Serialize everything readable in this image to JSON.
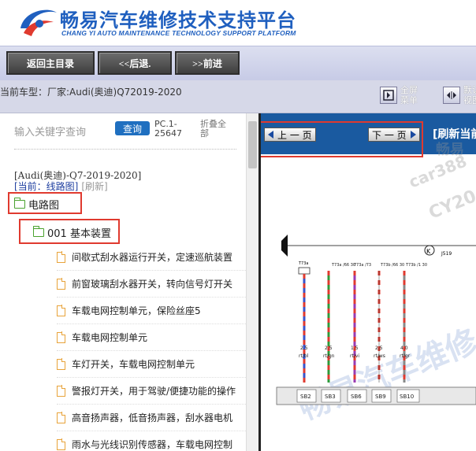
{
  "header": {
    "title": "畅易汽车维修技术支持平台",
    "subtitle": "CHANG YI AUTO MAINTENANCE TECHNOLOGY SUPPORT PLATFORM",
    "colors": {
      "brand": "#1f5fbf",
      "logo_red": "#e03a2f"
    }
  },
  "nav": {
    "home_label": "返回主目录",
    "back_label": "<<后退.",
    "forward_label": ">>前进"
  },
  "info": {
    "model_label": "当前车型：",
    "model_value": "厂家:Audi(奥迪)Q72019-2020",
    "fullscreen_label": "全屏\n菜单",
    "default_label": "默认\n视图"
  },
  "left": {
    "search_placeholder": "输入关键字查询",
    "search_button": "查询",
    "pc_label": "PC.1-25647",
    "fold_label": "折叠全部",
    "crumb_path": "[Audi(奥迪)-Q7-2019-2020]",
    "crumb_current": "[当前：线路图]",
    "crumb_refresh": "[刷新]",
    "tree_root": "电路图",
    "tree_child": "001 基本装置",
    "leaves": [
      "间歇式刮水器运行开关，定速巡航装置",
      "前窗玻璃刮水器开关，转向信号灯开关",
      "车载电网控制单元，保险丝座5",
      "车载电网控制单元",
      "车灯开关，车载电网控制单元",
      "警报灯开关，用于驾驶/便捷功能的操作",
      "高音扬声器，低音扬声器，刮水器电机",
      "雨水与光线识别传感器，车载电网控制"
    ]
  },
  "right": {
    "prev_page": "上 一 页",
    "next_page": "下 一 页",
    "refresh_current": "[刷新当前",
    "watermark_1": "畅易",
    "watermark_2": "car388",
    "watermark_3": "CY20",
    "watermark_4": "畅易汽车维修",
    "diagram": {
      "fuse_top_labels": [
        "T73a /66 30",
        "T73a /73",
        "T73b /66 30",
        "T73b /1 30"
      ],
      "wire_gauges": [
        "2.5",
        "2.5",
        "1.5",
        "2.5",
        "4.0"
      ],
      "wire_colors": [
        "rt/bl",
        "rt/gn",
        "rt/vi",
        "rt/ws",
        "rt/gr"
      ],
      "connectors": [
        "SB2",
        "SB3",
        "SB6",
        "SB9",
        "SB10"
      ],
      "component_label": "J519",
      "ground_symbol": "K",
      "relay_label": "T73a"
    }
  }
}
